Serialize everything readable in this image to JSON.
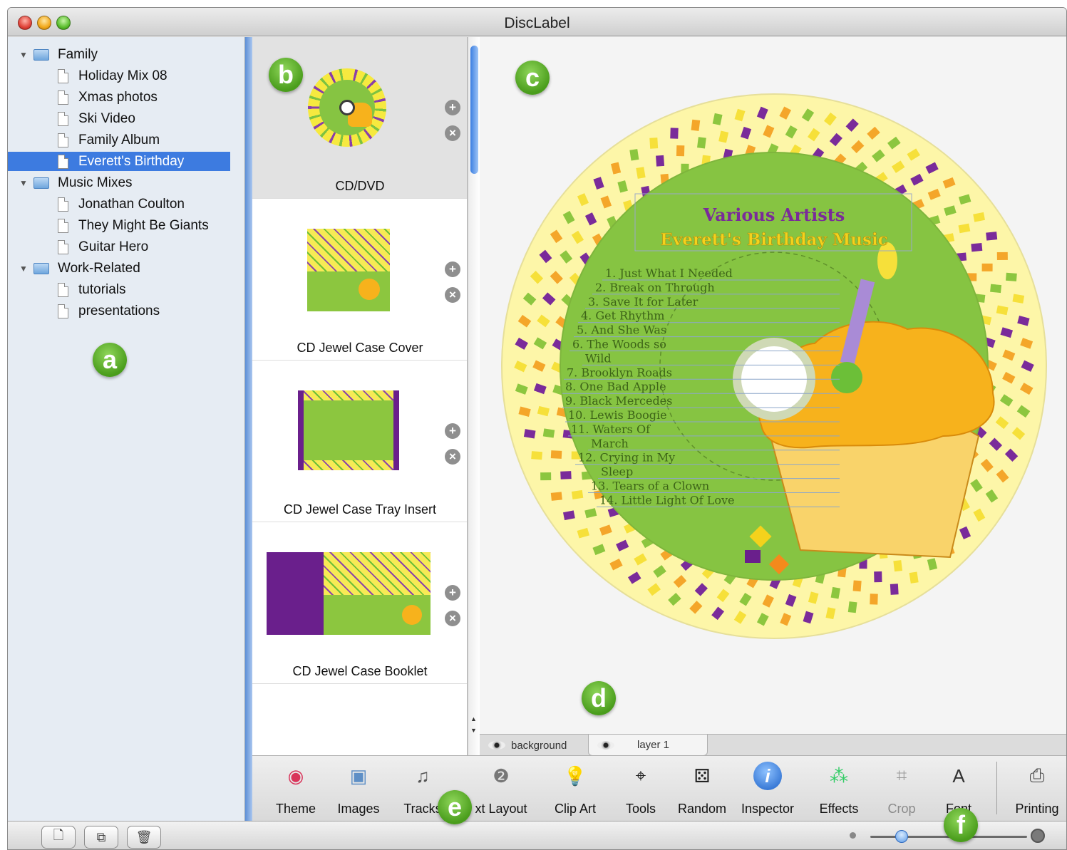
{
  "window": {
    "title": "DiscLabel"
  },
  "sidebar": {
    "groups": [
      {
        "label": "Family",
        "items": [
          "Holiday Mix 08",
          "Xmas photos",
          "Ski Video",
          "Family Album",
          "Everett's Birthday"
        ]
      },
      {
        "label": "Music Mixes",
        "items": [
          "Jonathan Coulton",
          "They Might Be Giants",
          "Guitar Hero"
        ]
      },
      {
        "label": "Work-Related",
        "items": [
          "tutorials",
          "presentations"
        ]
      }
    ],
    "selected_item": "Everett's Birthday"
  },
  "callouts": {
    "a": "a",
    "b": "b",
    "c": "c",
    "d": "d",
    "e": "e",
    "f": "f"
  },
  "templates": [
    {
      "label": "CD/DVD",
      "selected": true
    },
    {
      "label": "CD Jewel Case Cover",
      "selected": false
    },
    {
      "label": "CD Jewel Case Tray Insert",
      "selected": false
    },
    {
      "label": "CD Jewel Case Booklet",
      "selected": false
    }
  ],
  "template_buttons": {
    "add": "+",
    "remove": "×"
  },
  "disc": {
    "artist": "Various Artists",
    "title": "Everett's Birthday Music",
    "tracks": [
      "1. Just What I Needed",
      "2. Break on Through",
      "3. Save It for Later",
      "4. Get Rhythm",
      "5. And She Was",
      "6. The Woods so",
      "Wild",
      "7. Brooklyn Roads",
      "8. One Bad Apple",
      "9. Black Mercedes",
      "10. Lewis Boogie",
      "11. Waters Of",
      "March",
      "12. Crying in My",
      "Sleep",
      "13. Tears of a Clown",
      "14. Little Light Of Love"
    ],
    "colors": {
      "ring_bg": "#fdf6a8",
      "label_green": "#86c442",
      "title_color": "#7a2b9a",
      "subtitle_color": "#f4d21c",
      "cake": "#f7b21c",
      "candle": "#a98bd6"
    }
  },
  "layers": {
    "tabs": [
      "background",
      "layer 1"
    ],
    "active": "layer 1"
  },
  "toolbar": {
    "tools": [
      {
        "label": "Theme",
        "icon": "theme-icon",
        "enabled": true
      },
      {
        "label": "Images",
        "icon": "images-icon",
        "enabled": true
      },
      {
        "label": "Tracks",
        "icon": "tracks-icon",
        "enabled": true
      },
      {
        "label": "xt Layout",
        "icon": "text-layout-icon",
        "enabled": true
      },
      {
        "label": "Clip Art",
        "icon": "clip-art-icon",
        "enabled": true
      },
      {
        "label": "Tools",
        "icon": "tools-icon",
        "enabled": true
      },
      {
        "label": "Random",
        "icon": "dice-icon",
        "enabled": true
      },
      {
        "label": "Inspector",
        "icon": "inspector-icon",
        "enabled": true
      },
      {
        "label": "Effects",
        "icon": "effects-icon",
        "enabled": true
      },
      {
        "label": "Crop",
        "icon": "crop-icon",
        "enabled": false
      },
      {
        "label": "Font",
        "icon": "font-icon",
        "enabled": true
      },
      {
        "label": "Printing",
        "icon": "printer-icon",
        "enabled": true
      }
    ]
  },
  "bottom_bar": {
    "buttons": [
      "new-document-icon",
      "new-folder-icon",
      "trash-icon"
    ],
    "zoom_level": 0.2
  }
}
